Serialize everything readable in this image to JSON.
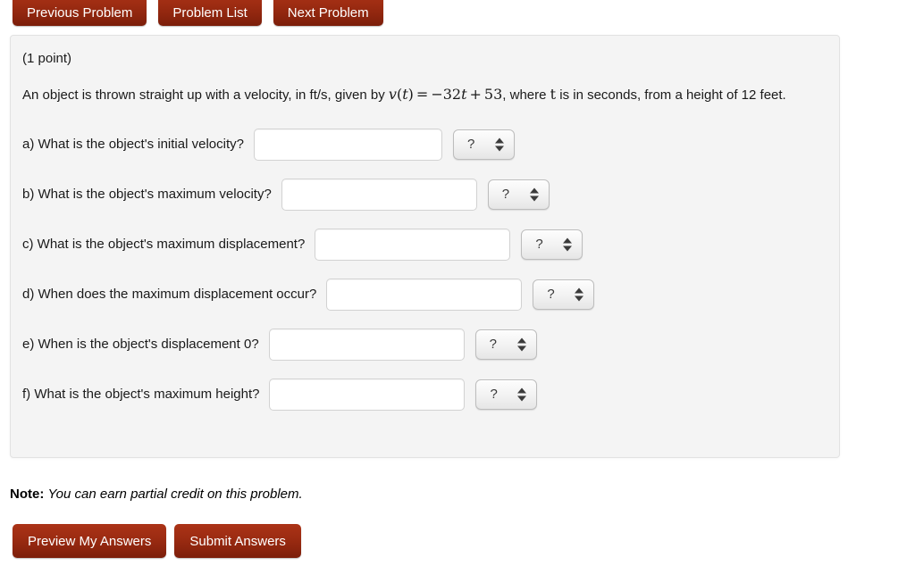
{
  "nav": {
    "buttons": [
      {
        "label": "Previous Problem",
        "name": "previous-problem-button"
      },
      {
        "label": "Problem List",
        "name": "problem-list-button"
      },
      {
        "label": "Next Problem",
        "name": "next-problem-button"
      }
    ]
  },
  "problem": {
    "points": "(1 point)",
    "statement_part1": "An object is thrown straight up with a velocity, in ft/s, given by ",
    "math": {
      "func": "v",
      "paren_open": "(",
      "arg": "t",
      "paren_close": ")",
      "equals": "=",
      "minus": "−",
      "coefficient": "32",
      "variable": "t",
      "plus": "+",
      "constant": "53"
    },
    "statement_part2": ", where ",
    "statement_var": "t",
    "statement_part3": " is in seconds, from a height of 12 feet."
  },
  "questions": [
    {
      "label": "a) What is the object's initial velocity?",
      "input_value": "",
      "input_placeholder": "",
      "unit_value": "?",
      "input_width": 211
    },
    {
      "label": "b) What is the object's maximum velocity?",
      "input_value": "",
      "input_placeholder": "",
      "unit_value": "?",
      "input_width": 219
    },
    {
      "label": "c) What is the object's maximum displacement?",
      "input_value": "",
      "input_placeholder": "",
      "unit_value": "?",
      "input_width": 219
    },
    {
      "label": "d) When does the maximum displacement occur?",
      "input_value": "",
      "input_placeholder": "",
      "unit_value": "?",
      "input_width": 219
    },
    {
      "label": "e) When is the object's displacement 0?",
      "input_value": "",
      "input_placeholder": "",
      "unit_value": "?",
      "input_width": 219
    },
    {
      "label": "f) What is the object's maximum height?",
      "input_value": "",
      "input_placeholder": "",
      "unit_value": "?",
      "input_width": 219
    }
  ],
  "note": {
    "prefix": "Note:",
    "text": "You can earn partial credit on this problem."
  },
  "actions": {
    "preview_label": "Preview My Answers",
    "submit_label": "Submit Answers"
  },
  "colors": {
    "button_top": "#ab3317",
    "button_bottom": "#7b1e0a",
    "panel_bg": "#f4f4f4",
    "panel_border": "#e2e2e2",
    "page_bg": "#ffffff",
    "text": "#1a1a1a"
  }
}
